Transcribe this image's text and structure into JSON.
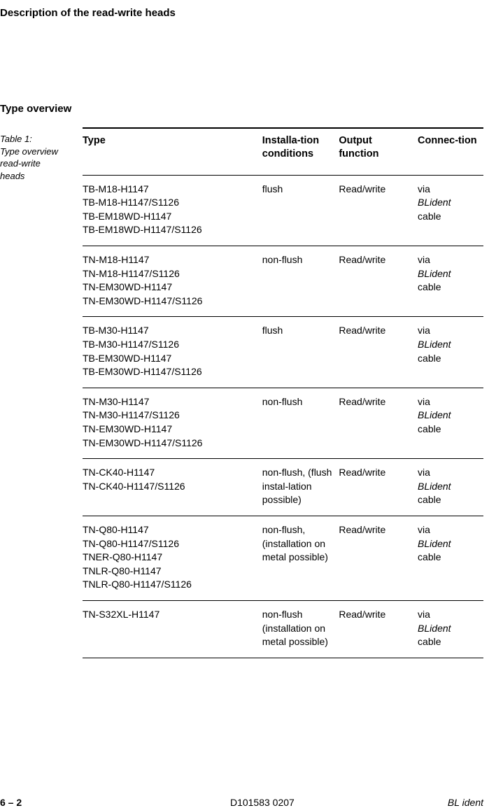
{
  "page_title": "Description of the read-write heads",
  "section_heading": "Type overview",
  "caption_lines": [
    "Table 1:",
    "Type overview",
    "read-write",
    "heads"
  ],
  "columns": {
    "type": "Type",
    "installation": "Installa-tion conditions",
    "output": "Output function",
    "connection": "Connec-tion"
  },
  "rows": [
    {
      "types": [
        "TB-M18-H1147",
        "TB-M18-H1147/S1126",
        "TB-EM18WD-H1147",
        "TB-EM18WD-H1147/S1126"
      ],
      "installation": "flush",
      "output": "Read/write",
      "conn_pre": "via",
      "conn_em": "BLident",
      "conn_post": "cable"
    },
    {
      "types": [
        "TN-M18-H1147",
        "TN-M18-H1147/S1126",
        "TN-EM30WD-H1147",
        "TN-EM30WD-H1147/S1126"
      ],
      "installation": "non-flush",
      "output": "Read/write",
      "conn_pre": "via",
      "conn_em": "BLident",
      "conn_post": "cable"
    },
    {
      "types": [
        "TB-M30-H1147",
        "TB-M30-H1147/S1126",
        "TB-EM30WD-H1147",
        "TB-EM30WD-H1147/S1126"
      ],
      "installation": "flush",
      "output": "Read/write",
      "conn_pre": "via",
      "conn_em": "BLident",
      "conn_post": "cable"
    },
    {
      "types": [
        "TN-M30-H1147",
        "TN-M30-H1147/S1126",
        "TN-EM30WD-H1147",
        "TN-EM30WD-H1147/S1126"
      ],
      "installation": "non-flush",
      "output": "Read/write",
      "conn_pre": "via",
      "conn_em": "BLident",
      "conn_post": "cable"
    },
    {
      "types": [
        "TN-CK40-H1147",
        "TN-CK40-H1147/S1126"
      ],
      "installation": "non-flush, (flush instal-lation possible)",
      "output": "Read/write",
      "conn_pre": "via",
      "conn_em": "BLident",
      "conn_post": "cable"
    },
    {
      "types": [
        "TN-Q80-H1147",
        "TN-Q80-H1147/S1126",
        "TNER-Q80-H1147",
        "TNLR-Q80-H1147",
        "TNLR-Q80-H1147/S1126"
      ],
      "installation": "non-flush, (installation on metal possible)",
      "output": "Read/write",
      "conn_pre": "via",
      "conn_em": "BLident",
      "conn_post": "cable"
    },
    {
      "types": [
        "TN-S32XL-H1147"
      ],
      "installation": "non-flush (installation on metal possible)",
      "output": "Read/write",
      "conn_pre": "via",
      "conn_em": "BLident",
      "conn_post": "cable"
    }
  ],
  "footer": {
    "page": "6 – 2",
    "doc": "D101583 0207",
    "brand": "BL ident"
  }
}
